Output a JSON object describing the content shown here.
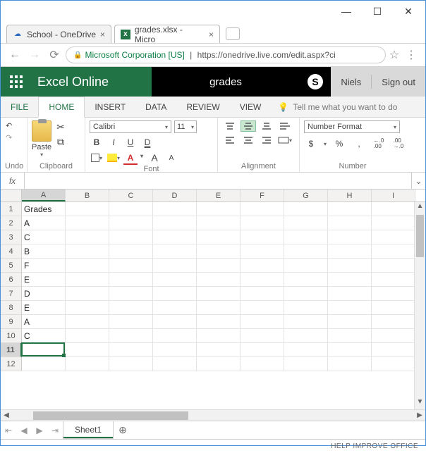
{
  "window": {
    "min": "—",
    "max": "☐",
    "close": "✕"
  },
  "browser": {
    "tabs": [
      {
        "title": "School - OneDrive",
        "favicon": "☁"
      },
      {
        "title": "grades.xlsx - Micro",
        "favicon": "x"
      }
    ],
    "back": "←",
    "fwd": "→",
    "reload": "⟳",
    "evcert": "Microsoft Corporation [US]",
    "url": "https://onedrive.live.com/edit.aspx?ci",
    "star": "☆",
    "menu": "⋮"
  },
  "header": {
    "brand": "Excel Online",
    "docname": "grades",
    "user": "Niels",
    "signout": "Sign out"
  },
  "ribbontabs": {
    "file": "FILE",
    "home": "HOME",
    "insert": "INSERT",
    "data": "DATA",
    "review": "REVIEW",
    "view": "VIEW",
    "tellme": "Tell me what you want to do"
  },
  "ribbon": {
    "undo_label": "Undo",
    "clipboard_label": "Clipboard",
    "paste": "Paste",
    "font_label": "Font",
    "fontname": "Calibri",
    "fontsize": "11",
    "bold": "B",
    "italic": "I",
    "underline": "U",
    "dunder": "D",
    "grow": "A",
    "shrink": "A",
    "align_label": "Alignment",
    "number_label": "Number",
    "numfmt": "Number Format",
    "currency": "$",
    "percent": "%",
    "comma": ",",
    "decinc": "←.0\n.00",
    "decdec": ".00\n→.0"
  },
  "fx": {
    "label": "fx",
    "value": ""
  },
  "grid": {
    "columns": [
      "A",
      "B",
      "C",
      "D",
      "E",
      "F",
      "G",
      "H",
      "I"
    ],
    "rows": [
      "1",
      "2",
      "3",
      "4",
      "5",
      "6",
      "7",
      "8",
      "9",
      "10",
      "11",
      "12"
    ],
    "selected_col": 0,
    "selected_row": 10,
    "data": {
      "A1": "Grades",
      "A2": "A",
      "A3": "C",
      "A4": "B",
      "A5": "F",
      "A6": "E",
      "A7": "D",
      "A8": "E",
      "A9": "A",
      "A10": "C"
    }
  },
  "chart_data": {
    "type": "table",
    "title": "Grades",
    "categories": [
      "Row 2",
      "Row 3",
      "Row 4",
      "Row 5",
      "Row 6",
      "Row 7",
      "Row 8",
      "Row 9",
      "Row 10"
    ],
    "values": [
      "A",
      "C",
      "B",
      "F",
      "E",
      "D",
      "E",
      "A",
      "C"
    ]
  },
  "sheet": {
    "name": "Sheet1",
    "add": "⊕"
  },
  "status": {
    "help": "HELP IMPROVE OFFICE"
  }
}
